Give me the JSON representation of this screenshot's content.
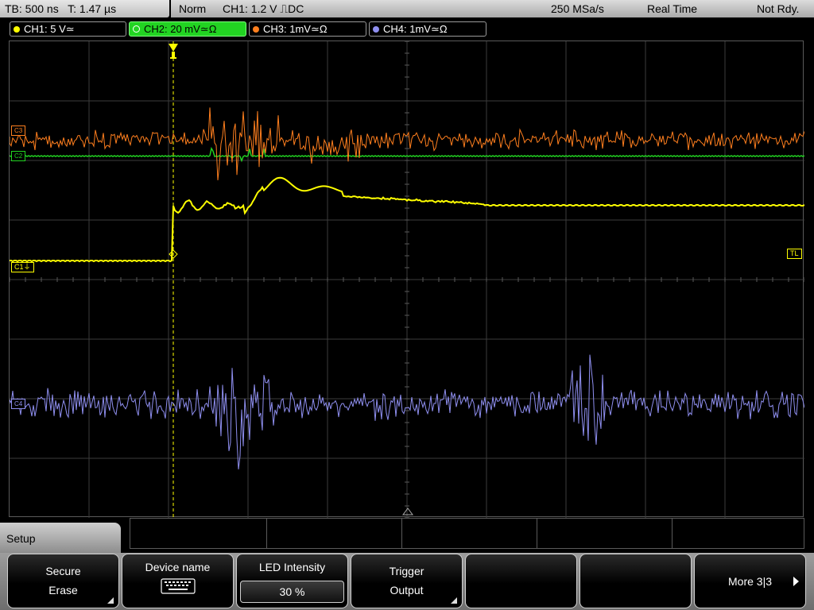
{
  "top_bar": {
    "timebase": "TB: 500 ns",
    "trigger_time": "T: 1.47 µs",
    "mode": "Norm",
    "trigger_setting": "CH1: 1.2 V ⎍DC",
    "sample_rate": "250 MSa/s",
    "acq_mode": "Real Time",
    "status": "Not Rdy."
  },
  "channels": [
    {
      "label": "CH1: 5 V≃",
      "color": "#ffff00"
    },
    {
      "label": "CH2: 20 mV≃Ω",
      "color": "#22d322",
      "active": true
    },
    {
      "label": "CH3: 1mV≃Ω",
      "color": "#ff7f1e"
    },
    {
      "label": "CH4: 1mV≃Ω",
      "color": "#8f8ff0"
    }
  ],
  "plot": {
    "ch1_marker": "C1",
    "trigger_level_marker": "TL",
    "ch2_marker": "C2",
    "ch3_marker": "C3",
    "ch4_marker": "C4"
  },
  "menu": {
    "title": "Setup",
    "softkeys": {
      "secure_erase": {
        "line1": "Secure",
        "line2": "Erase"
      },
      "device_name": {
        "line1": "Device name"
      },
      "led_intensity": {
        "line1": "LED Intensity",
        "value": "30 %"
      },
      "trigger_output": {
        "line1": "Trigger",
        "line2": "Output"
      },
      "more": {
        "label": "More 3|3"
      }
    }
  },
  "icons": [
    "keyboard-icon",
    "corner-arrow-icon",
    "trigger-marker-icon",
    "right-arrow-icon"
  ]
}
